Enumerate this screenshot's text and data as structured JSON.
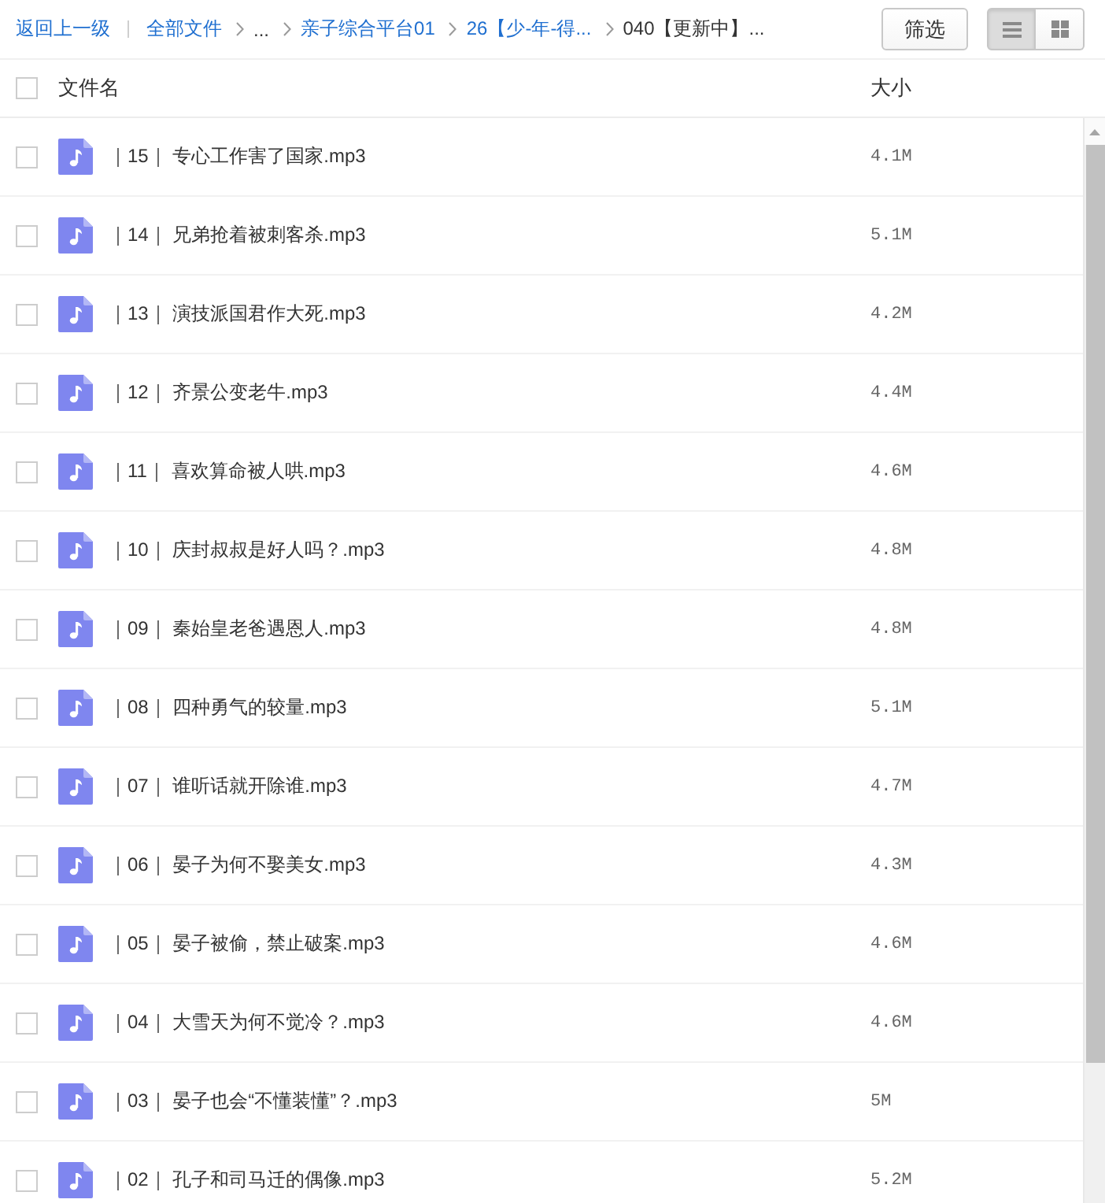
{
  "toolbar": {
    "back_link": "返回上一级",
    "breadcrumbs": [
      {
        "kind": "link",
        "label": "全部文件"
      },
      {
        "kind": "ellipsis",
        "label": "..."
      },
      {
        "kind": "link",
        "label": "亲子综合平台01"
      },
      {
        "kind": "link",
        "label": "26【少-年-得..."
      },
      {
        "kind": "current",
        "label": "040【更新中】..."
      }
    ],
    "filter_button": "筛选",
    "view_modes": [
      {
        "kind": "list",
        "selected": true
      },
      {
        "kind": "grid",
        "selected": false
      }
    ]
  },
  "table": {
    "select_all": {
      "checked": false
    },
    "columns": [
      {
        "label": "文件名"
      },
      {
        "label": "大小"
      }
    ],
    "rows": [
      {
        "checked": false,
        "name": "｜15｜ 专心工作害了国家.mp3",
        "size": "4.1M"
      },
      {
        "checked": false,
        "name": "｜14｜ 兄弟抢着被刺客杀.mp3",
        "size": "5.1M"
      },
      {
        "checked": false,
        "name": "｜13｜ 演技派国君作大死.mp3",
        "size": "4.2M"
      },
      {
        "checked": false,
        "name": "｜12｜ 齐景公变老牛.mp3",
        "size": "4.4M"
      },
      {
        "checked": false,
        "name": "｜11｜ 喜欢算命被人哄.mp3",
        "size": "4.6M"
      },
      {
        "checked": false,
        "name": "｜10｜ 庆封叔叔是好人吗？.mp3",
        "size": "4.8M"
      },
      {
        "checked": false,
        "name": "｜09｜ 秦始皇老爸遇恩人.mp3",
        "size": "4.8M"
      },
      {
        "checked": false,
        "name": "｜08｜ 四种勇气的较量.mp3",
        "size": "5.1M"
      },
      {
        "checked": false,
        "name": "｜07｜ 谁听话就开除谁.mp3",
        "size": "4.7M"
      },
      {
        "checked": false,
        "name": "｜06｜ 晏子为何不娶美女.mp3",
        "size": "4.3M"
      },
      {
        "checked": false,
        "name": "｜05｜ 晏子被偷，禁止破案.mp3",
        "size": "4.6M"
      },
      {
        "checked": false,
        "name": "｜04｜ 大雪天为何不觉冷？.mp3",
        "size": "4.6M"
      },
      {
        "checked": false,
        "name": "｜03｜ 晏子也会“不懂装懂”？.mp3",
        "size": "5M"
      },
      {
        "checked": false,
        "name": "｜02｜ 孔子和司马迁的偶像.mp3",
        "size": "5.2M"
      }
    ]
  }
}
